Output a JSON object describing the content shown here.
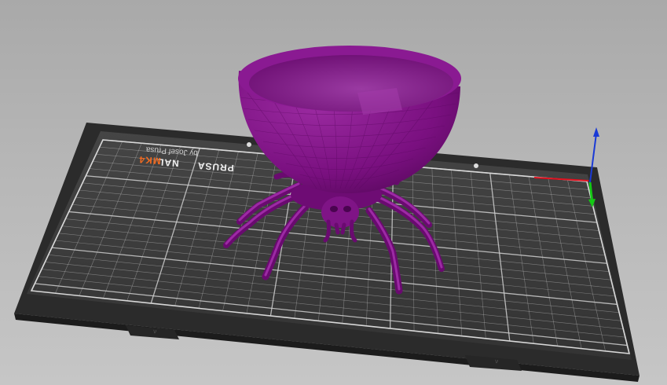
{
  "viewport": {
    "background_top": "#a9a9a9",
    "background_bottom": "#c6c6c6"
  },
  "bed": {
    "logo_prefix": "NAL",
    "logo_brand": "PRUSA",
    "logo_model": "MK4",
    "byline": "by Josef Prusa",
    "frame_color": "#2b2b2b",
    "sheet_color": "#3d3d3d",
    "grid_color": "#cfcfcf",
    "accent_color": "#f26b21"
  },
  "model": {
    "name": "spider-bowl",
    "color": "#7a1080"
  },
  "axes": {
    "x_color": "#e0101e",
    "y_color": "#14c814",
    "z_color": "#1a3ad6"
  }
}
